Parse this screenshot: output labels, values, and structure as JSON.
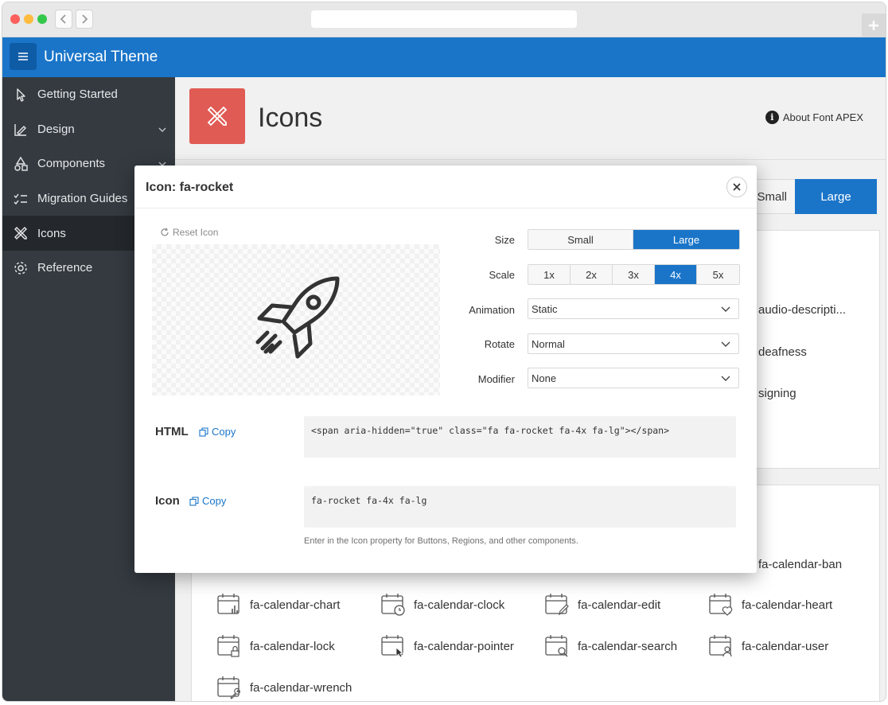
{
  "app": {
    "title": "Universal Theme"
  },
  "sidebar": {
    "items": [
      {
        "label": "Getting Started",
        "icon": "pointer-icon",
        "expandable": false,
        "active": false
      },
      {
        "label": "Design",
        "icon": "design-icon",
        "expandable": true,
        "active": false
      },
      {
        "label": "Components",
        "icon": "shapes-icon",
        "expandable": true,
        "active": false
      },
      {
        "label": "Migration Guides",
        "icon": "checklist-icon",
        "expandable": false,
        "active": false
      },
      {
        "label": "Icons",
        "icon": "pencil-ruler-icon",
        "expandable": false,
        "active": true
      },
      {
        "label": "Reference",
        "icon": "gear-icon",
        "expandable": false,
        "active": false
      }
    ]
  },
  "page": {
    "title": "Icons",
    "about_link": "About Font APEX",
    "size_toggle": {
      "small": "Small",
      "large": "Large"
    },
    "partial_items": [
      "audio-descripti...",
      "deafness",
      "signing",
      "fa-calendar-ban"
    ],
    "icon_grid": [
      "fa-calendar-chart",
      "fa-calendar-clock",
      "fa-calendar-edit",
      "fa-calendar-heart",
      "fa-calendar-lock",
      "fa-calendar-pointer",
      "fa-calendar-search",
      "fa-calendar-user",
      "fa-calendar-wrench"
    ]
  },
  "modal": {
    "title": "Icon: fa-rocket",
    "reset_label": "Reset Icon",
    "size": {
      "label": "Size",
      "options": [
        "Small",
        "Large"
      ],
      "selected": "Large"
    },
    "scale": {
      "label": "Scale",
      "options": [
        "1x",
        "2x",
        "3x",
        "4x",
        "5x"
      ],
      "selected": "4x"
    },
    "animation": {
      "label": "Animation",
      "value": "Static"
    },
    "rotate": {
      "label": "Rotate",
      "value": "Normal"
    },
    "modifier": {
      "label": "Modifier",
      "value": "None"
    },
    "html": {
      "label": "HTML",
      "copy": "Copy",
      "code": "<span aria-hidden=\"true\" class=\"fa fa-rocket fa-4x fa-lg\"></span>"
    },
    "icon": {
      "label": "Icon",
      "copy": "Copy",
      "code": "fa-rocket fa-4x fa-lg"
    },
    "help_text": "Enter in the Icon property for Buttons, Regions, and other components."
  },
  "colors": {
    "brand": "#1a75c9",
    "sidebar": "#343a40",
    "page_icon": "#e05b54"
  }
}
